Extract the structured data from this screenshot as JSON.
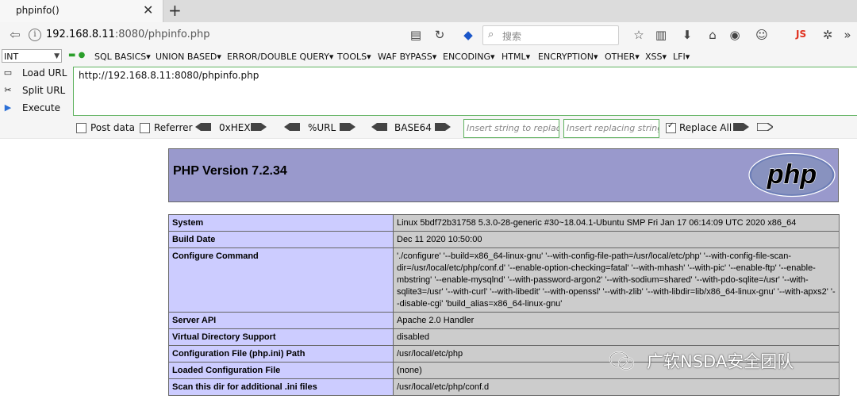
{
  "browser": {
    "tab_title": "phpinfo()",
    "tab_close": "✕",
    "new_tab": "+",
    "url_host": "192.168.8.11",
    "url_rest": ":8080/phpinfo.php",
    "search_placeholder": "搜索",
    "js_label": "JS"
  },
  "hackbar": {
    "select_value": "INT",
    "menu": [
      "SQL BASICS",
      "UNION BASED",
      "ERROR/DOUBLE QUERY",
      "TOOLS",
      "WAF BYPASS",
      "ENCODING",
      "HTML",
      "ENCRYPTION",
      "OTHER",
      "XSS",
      "LFI"
    ],
    "load_url": "Load URL",
    "split_url": "Split URL",
    "execute": "Execute",
    "url_value": "http://192.168.8.11:8080/phpinfo.php",
    "post_data": "Post data",
    "referrer": "Referrer",
    "hex": "0xHEX",
    "url_enc": "%URL",
    "base64": "BASE64",
    "insert_placeholder": "Insert string to replace",
    "replacing_placeholder": "Insert replacing string",
    "replace_all": "Replace All"
  },
  "phpinfo": {
    "version": "PHP Version 7.2.34",
    "logo_text": "php",
    "rows": [
      {
        "key": "System",
        "value": "Linux 5bdf72b31758 5.3.0-28-generic #30~18.04.1-Ubuntu SMP Fri Jan 17 06:14:09 UTC 2020 x86_64"
      },
      {
        "key": "Build Date",
        "value": "Dec 11 2020 10:50:00"
      },
      {
        "key": "Configure Command",
        "value": "'./configure' '--build=x86_64-linux-gnu' '--with-config-file-path=/usr/local/etc/php' '--with-config-file-scan-dir=/usr/local/etc/php/conf.d' '--enable-option-checking=fatal' '--with-mhash' '--with-pic' '--enable-ftp' '--enable-mbstring' '--enable-mysqlnd' '--with-password-argon2' '--with-sodium=shared' '--with-pdo-sqlite=/usr' '--with-sqlite3=/usr' '--with-curl' '--with-libedit' '--with-openssl' '--with-zlib' '--with-libdir=lib/x86_64-linux-gnu' '--with-apxs2' '--disable-cgi' 'build_alias=x86_64-linux-gnu'"
      },
      {
        "key": "Server API",
        "value": "Apache 2.0 Handler"
      },
      {
        "key": "Virtual Directory Support",
        "value": "disabled"
      },
      {
        "key": "Configuration File (php.ini) Path",
        "value": "/usr/local/etc/php"
      },
      {
        "key": "Loaded Configuration File",
        "value": "(none)"
      },
      {
        "key": "Scan this dir for additional .ini files",
        "value": "/usr/local/etc/php/conf.d"
      }
    ]
  },
  "watermark": "广软NSDA安全团队",
  "colors": {
    "header_bg": "#9999cc",
    "key_bg": "#ccccff",
    "value_bg": "#cccccc",
    "accent_green": "#5fb25f"
  }
}
